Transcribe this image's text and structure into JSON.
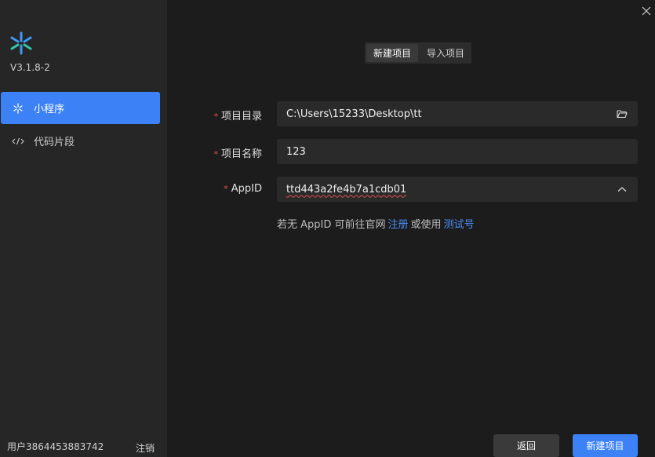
{
  "sidebar": {
    "version": "V3.1.8-2",
    "items": [
      {
        "label": "小程序",
        "icon": "asterisk-icon"
      },
      {
        "label": "代码片段",
        "icon": "code-icon"
      }
    ],
    "user": "用户3864453883742",
    "logout": "注销"
  },
  "tabs": [
    {
      "label": "新建项目",
      "active": true
    },
    {
      "label": "导入项目",
      "active": false
    }
  ],
  "form": {
    "required_mark": "*",
    "dir_label": "项目目录",
    "dir_value": "C:\\Users\\15233\\Desktop\\tt",
    "name_label": "项目名称",
    "name_value": "123",
    "appid_label": "AppID",
    "appid_value": "ttd443a2fe4b7a1cdb01",
    "hint_prefix": "若无 AppID 可前往官网",
    "hint_register": "注册",
    "hint_middle": "或使用",
    "hint_test": "测试号"
  },
  "buttons": {
    "back": "返回",
    "create": "新建项目"
  },
  "colors": {
    "accent": "#3c82f6",
    "required": "#e34d4d",
    "link": "#4a8df7"
  }
}
